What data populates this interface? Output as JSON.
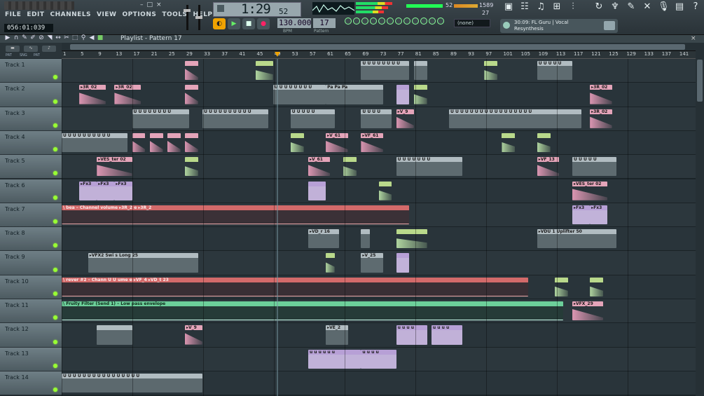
{
  "menu": [
    "FILE",
    "EDIT",
    "CHANNELS",
    "VIEW",
    "OPTIONS",
    "TOOLS",
    "HELP"
  ],
  "window_buttons": [
    "–",
    "□",
    "×"
  ],
  "position_display": "056:01:039",
  "clock": {
    "main": "1:29",
    "sub": "52"
  },
  "tempo": {
    "value": "130.000",
    "label": "BPM"
  },
  "pattern": {
    "value": "17",
    "label": "Pattern"
  },
  "cpu": {
    "value1": "52",
    "value2": "1589",
    "value3": "27"
  },
  "snap": "(none)",
  "hint": {
    "line1": "30:09: FL Guru | Vocal",
    "line2": "Resynthesis"
  },
  "playlist": {
    "title": "Playlist - Pattern 17"
  },
  "options_buttons": [
    "PAT",
    "SNG",
    "PAT"
  ],
  "ruler_ticks": [
    "1",
    "5",
    "9",
    "13",
    "17",
    "21",
    "25",
    "29",
    "33",
    "37",
    "41",
    "45",
    "49",
    "53",
    "57",
    "61",
    "65",
    "69",
    "73",
    "77",
    "81",
    "85",
    "89",
    "93",
    "97",
    "101",
    "105",
    "109",
    "113",
    "117",
    "121",
    "125",
    "129",
    "133",
    "137",
    "141"
  ],
  "tracks": [
    {
      "name": "Track 1"
    },
    {
      "name": "Track 2"
    },
    {
      "name": "Track 3"
    },
    {
      "name": "Track 4"
    },
    {
      "name": "Track 5"
    },
    {
      "name": "Track 6"
    },
    {
      "name": "Track 7"
    },
    {
      "name": "Track 8"
    },
    {
      "name": "Track 9"
    },
    {
      "name": "Track 10"
    },
    {
      "name": "Track 11"
    },
    {
      "name": "Track 12"
    },
    {
      "name": "Track 13"
    },
    {
      "name": "Track 14"
    }
  ],
  "clips": [
    {
      "track": 0,
      "bar": 45,
      "len": 4,
      "color": "green",
      "label": ""
    },
    {
      "track": 0,
      "bar": 29,
      "len": 3,
      "color": "pink",
      "label": ""
    },
    {
      "track": 0,
      "bar": 69,
      "len": 11,
      "color": "gray",
      "label": "U U U U U U U U"
    },
    {
      "track": 0,
      "bar": 81,
      "len": 3,
      "color": "gray",
      "label": ""
    },
    {
      "track": 0,
      "bar": 97,
      "len": 3,
      "color": "green",
      "label": ""
    },
    {
      "track": 0,
      "bar": 109,
      "len": 8,
      "color": "gray",
      "label": "U U U U U"
    },
    {
      "track": 1,
      "bar": 5,
      "len": 6,
      "color": "pink",
      "label": "▸3R_02"
    },
    {
      "track": 1,
      "bar": 13,
      "len": 6,
      "color": "pink",
      "label": "▸3R_02"
    },
    {
      "track": 1,
      "bar": 29,
      "len": 3,
      "color": "pink",
      "label": ""
    },
    {
      "track": 1,
      "bar": 49,
      "len": 12,
      "color": "gray",
      "label": "U U U U U U U U"
    },
    {
      "track": 1,
      "bar": 61,
      "len": 13,
      "color": "gray",
      "label": "Pa  Pa  Pa"
    },
    {
      "track": 1,
      "bar": 77,
      "len": 3,
      "color": "lav",
      "label": ""
    },
    {
      "track": 1,
      "bar": 81,
      "len": 3,
      "color": "green",
      "label": ""
    },
    {
      "track": 1,
      "bar": 121,
      "len": 5,
      "color": "pink",
      "label": "▸3R_02"
    },
    {
      "track": 2,
      "bar": 17,
      "len": 13,
      "color": "gray",
      "label": "U U U U U U U U"
    },
    {
      "track": 2,
      "bar": 33,
      "len": 15,
      "color": "gray",
      "label": "U U U U U U U U U U"
    },
    {
      "track": 2,
      "bar": 53,
      "len": 10,
      "color": "gray",
      "label": "U U U U U"
    },
    {
      "track": 2,
      "bar": 69,
      "len": 7,
      "color": "gray",
      "label": "U U U U"
    },
    {
      "track": 2,
      "bar": 77,
      "len": 4,
      "color": "pink",
      "label": "▸V_9"
    },
    {
      "track": 2,
      "bar": 89,
      "len": 30,
      "color": "gray",
      "label": "U U U U U U U U U U U U U U U U U"
    },
    {
      "track": 2,
      "bar": 121,
      "len": 5,
      "color": "pink",
      "label": "▸3R_02"
    },
    {
      "track": 3,
      "bar": 1,
      "len": 15,
      "color": "gray",
      "label": "U U U U U U U U U U"
    },
    {
      "track": 3,
      "bar": 17,
      "len": 3,
      "color": "pink",
      "label": ""
    },
    {
      "track": 3,
      "bar": 21,
      "len": 3,
      "color": "pink",
      "label": ""
    },
    {
      "track": 3,
      "bar": 25,
      "len": 3,
      "color": "pink",
      "label": ""
    },
    {
      "track": 3,
      "bar": 29,
      "len": 3,
      "color": "pink",
      "label": ""
    },
    {
      "track": 3,
      "bar": 53,
      "len": 3,
      "color": "green",
      "label": ""
    },
    {
      "track": 3,
      "bar": 61,
      "len": 5,
      "color": "pink",
      "label": "▸V_61"
    },
    {
      "track": 3,
      "bar": 69,
      "len": 5,
      "color": "pink",
      "label": "▸VF_61"
    },
    {
      "track": 3,
      "bar": 101,
      "len": 3,
      "color": "green",
      "label": ""
    },
    {
      "track": 3,
      "bar": 109,
      "len": 3,
      "color": "green",
      "label": ""
    },
    {
      "track": 4,
      "bar": 9,
      "len": 8,
      "color": "pink",
      "label": "▸VES_ter 02"
    },
    {
      "track": 4,
      "bar": 29,
      "len": 3,
      "color": "green",
      "label": ""
    },
    {
      "track": 4,
      "bar": 57,
      "len": 5,
      "color": "pink",
      "label": "▸V_61"
    },
    {
      "track": 4,
      "bar": 65,
      "len": 3,
      "color": "green",
      "label": ""
    },
    {
      "track": 4,
      "bar": 77,
      "len": 15,
      "color": "gray",
      "label": "U U U U U U U"
    },
    {
      "track": 4,
      "bar": 109,
      "len": 5,
      "color": "pink",
      "label": "▸VF_13"
    },
    {
      "track": 4,
      "bar": 117,
      "len": 10,
      "color": "gray",
      "label": "U U U U U"
    },
    {
      "track": 5,
      "bar": 5,
      "len": 4,
      "color": "lav",
      "label": "▸Fx3"
    },
    {
      "track": 5,
      "bar": 9,
      "len": 4,
      "color": "lav",
      "label": "▸Fx3"
    },
    {
      "track": 5,
      "bar": 13,
      "len": 4,
      "color": "lav",
      "label": "▸Fx3"
    },
    {
      "track": 5,
      "bar": 57,
      "len": 4,
      "color": "lav",
      "label": ""
    },
    {
      "track": 5,
      "bar": 73,
      "len": 3,
      "color": "green",
      "label": ""
    },
    {
      "track": 5,
      "bar": 117,
      "len": 8,
      "color": "pink",
      "label": "▸VES_ter 02"
    },
    {
      "track": 6,
      "bar": 1,
      "len": 79,
      "color": "auto",
      "label": "\\ bea – Channel volume   ▸3R_2 e   ▸3R_2"
    },
    {
      "track": 6,
      "bar": 117,
      "len": 4,
      "color": "lav",
      "label": "▸Fx3"
    },
    {
      "track": 6,
      "bar": 121,
      "len": 4,
      "color": "lav",
      "label": "▸Fx3"
    },
    {
      "track": 7,
      "bar": 57,
      "len": 7,
      "color": "gray",
      "label": "▸VD_r 16"
    },
    {
      "track": 7,
      "bar": 69,
      "len": 2,
      "color": "gray",
      "label": ""
    },
    {
      "track": 7,
      "bar": 77,
      "len": 7,
      "color": "green",
      "label": ""
    },
    {
      "track": 7,
      "bar": 109,
      "len": 18,
      "color": "gray",
      "label": "▸VDU 1 Uplifter 50"
    },
    {
      "track": 8,
      "bar": 7,
      "len": 25,
      "color": "gray",
      "label": "▸VFX2 Swi  s Long 25"
    },
    {
      "track": 8,
      "bar": 61,
      "len": 2,
      "color": "green",
      "label": ""
    },
    {
      "track": 8,
      "bar": 69,
      "len": 5,
      "color": "gray",
      "label": "▸V_25"
    },
    {
      "track": 8,
      "bar": 77,
      "len": 3,
      "color": "lav",
      "label": ""
    },
    {
      "track": 9,
      "bar": 1,
      "len": 106,
      "color": "auto",
      "label": "\\ rever #2 – Chann  U U  ume e  ▸VF_4        ▸VD_t 23"
    },
    {
      "track": 9,
      "bar": 113,
      "len": 3,
      "color": "green",
      "label": ""
    },
    {
      "track": 9,
      "bar": 121,
      "len": 3,
      "color": "green",
      "label": ""
    },
    {
      "track": 10,
      "bar": 1,
      "len": 114,
      "color": "autog",
      "label": "\\ Fruity Filter (Send 1) – Low pass envelope"
    },
    {
      "track": 10,
      "bar": 117,
      "len": 7,
      "color": "pink",
      "label": "▸VFX_29"
    },
    {
      "track": 11,
      "bar": 9,
      "len": 8,
      "color": "gray",
      "label": ""
    },
    {
      "track": 11,
      "bar": 29,
      "len": 4,
      "color": "pink",
      "label": "▸V_9"
    },
    {
      "track": 11,
      "bar": 61,
      "len": 5,
      "color": "gray",
      "label": "▸VE_2"
    },
    {
      "track": 11,
      "bar": 77,
      "len": 7,
      "color": "lav",
      "label": "u u u u"
    },
    {
      "track": 11,
      "bar": 85,
      "len": 7,
      "color": "lav",
      "label": "u u u u"
    },
    {
      "track": 12,
      "bar": 57,
      "len": 12,
      "color": "lav",
      "label": "u u u u u u"
    },
    {
      "track": 12,
      "bar": 69,
      "len": 8,
      "color": "lav",
      "label": "u u u u"
    },
    {
      "track": 13,
      "bar": 1,
      "len": 32,
      "color": "gray",
      "label": "U U U U U U U U U U U U U U U U"
    }
  ]
}
